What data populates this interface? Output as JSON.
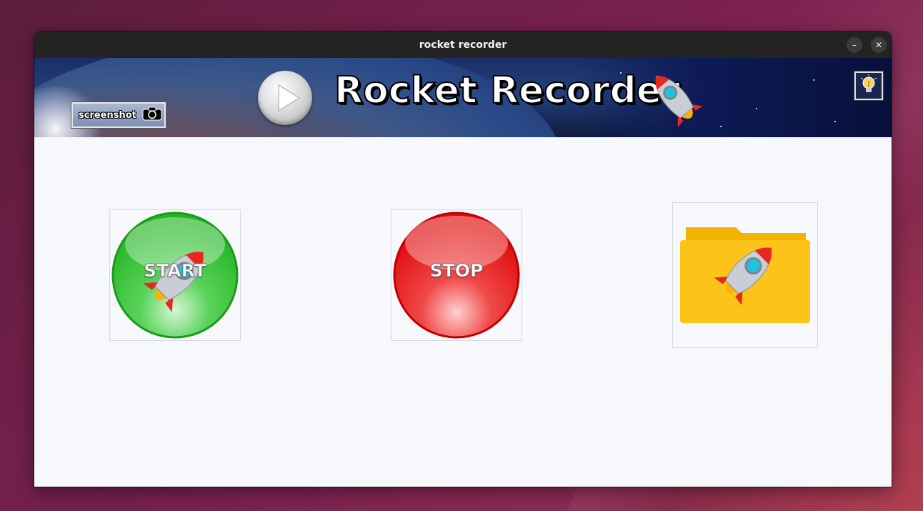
{
  "window": {
    "title": "rocket recorder",
    "minimize_glyph": "–",
    "close_glyph": "✕"
  },
  "banner": {
    "app_title": "Rocket Recorder",
    "screenshot_label": "screenshot",
    "icons": [
      "camera-icon",
      "play-icon",
      "rocket-icon",
      "lightbulb-icon"
    ]
  },
  "controls": {
    "start_label": "START",
    "stop_label": "STOP",
    "folder_icon": "folder-rocket-icon"
  },
  "colors": {
    "start_green": "#2ec32e",
    "stop_red": "#e01010",
    "folder_yellow": "#fcc419",
    "titlebar": "#232323",
    "content_bg": "#f6f8fc"
  }
}
